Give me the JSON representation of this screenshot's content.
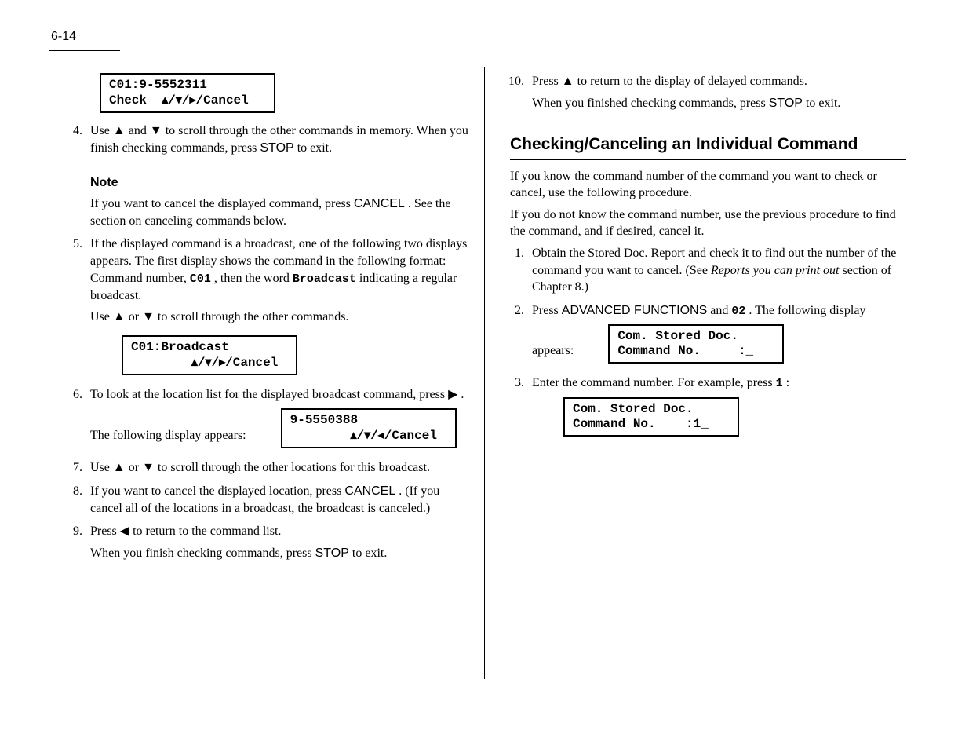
{
  "page_number": "6-14",
  "left": {
    "lcd1": {
      "l1": "C01:9-5552311",
      "l2a": "Check  ",
      "l2b": "/Cancel"
    },
    "step4": {
      "prefix": "Use ",
      "mid": " and ",
      "suffix": " to scroll through the other commands in memory.  When you finish checking commands, press ",
      "end": " to exit."
    },
    "note_head": "Note",
    "note_body": {
      "prefix": "If you want to cancel the displayed command, press ",
      "after": ".  See the section on canceling commands below."
    },
    "step5": {
      "prefix": "If the displayed command is a broadcast, one of the following two displays appears.  The first display shows the command in the following format:  Command number, ",
      "mid": ", then the word ",
      "end": " indicating a regular broadcast."
    },
    "broadcast_word": "Broadcast",
    "lcd2": {
      "l1": "C01:Broadcast",
      "pad": "        ",
      "l2b": "/Cancel"
    },
    "step6a": {
      "prefix": "To look at the location list for the displayed broadcast command, press ",
      "suffix": ".  The following display appears:"
    },
    "lcd3": {
      "l1": "9-5550388",
      "pad": "        ",
      "l2b": "/Cancel"
    },
    "step7": {
      "prefix": "Use ",
      "mid": " or ",
      "suffix": " to scroll through the other locations for this broadcast."
    },
    "step8": {
      "prefix": "If you want to cancel the displayed location, press ",
      "after": ".  (If you cancel all of the locations in a broadcast, the broadcast is canceled.)"
    },
    "step9a": {
      "prefix": "Press ",
      "suffix": " to return to the command list."
    },
    "step9b": {
      "prefix": "When you finish checking commands, press ",
      "suffix": " to exit."
    },
    "stop_label": "STOP",
    "cancel_label": "CANCEL"
  },
  "right": {
    "step10a": {
      "prefix": "Press ",
      "suffix": " to return to the display of delayed commands."
    },
    "step10b": {
      "prefix": "When you finished checking commands, press ",
      "suffix": " to exit."
    },
    "section_title": "Checking/Canceling an Individual Command",
    "intro_1": "If you know the command number of the command you want to check or cancel, use the following procedure.",
    "intro_2": "If you do not know the command number, use the previous procedure to find the command, and if desired, cancel it.",
    "step1": {
      "prefix": "Obtain the Stored Doc. Report and check it to find out the number of the command you want to cancel.  (See ",
      "link": "Reports you can print out",
      "suffix": "section of Chapter 8.)"
    },
    "step2": {
      "prefix": "Press ",
      "mid": " and ",
      "suffix": ".  The following display appears:"
    },
    "key_advanced": "ADVANCED FUNCTIONS",
    "key_02": "02",
    "lcd4": {
      "l1": "Com. Stored Doc.",
      "l2": "Command No.     :_"
    },
    "step3": {
      "prefix": "Enter the command number.  For example, press ",
      "suffix": ":"
    },
    "digit_1": "1",
    "lcd5": {
      "l1": "Com. Stored Doc.",
      "l2": "Command No.    :1_"
    },
    "stop_label": "STOP"
  }
}
